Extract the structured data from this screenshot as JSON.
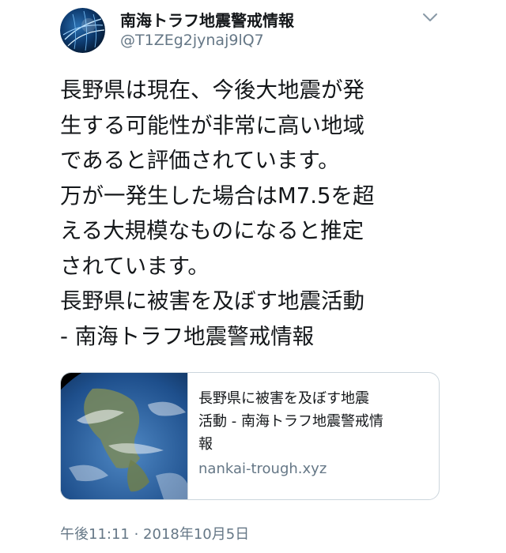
{
  "account": {
    "display_name": "南海トラフ地震警戒情報",
    "handle": "@T1ZEg2jynaj9lQ7"
  },
  "icons": {
    "avatar": "globe-network-avatar",
    "menu": "chevron-down-icon",
    "card_image": "earth-globe-image"
  },
  "tweet": {
    "lines": [
      "長野県は現在、今後大地震が発",
      "生する可能性が非常に高い地域",
      "であると評価されています。",
      "万が一発生した場合はM7.5を超",
      "える大規模なものになると推定",
      "されています。",
      "長野県に被害を及ぼす地震活動",
      "- 南海トラフ地震警戒情報"
    ]
  },
  "card": {
    "title_lines": [
      "長野県に被害を及ぼす地震",
      "活動 - 南海トラフ地震警戒情",
      "報"
    ],
    "domain": "nankai-trough.xyz"
  },
  "timestamp": "午後11:11 · 2018年10月5日",
  "colors": {
    "text": "#14171a",
    "secondary": "#657786",
    "border": "#ccd6dd"
  }
}
